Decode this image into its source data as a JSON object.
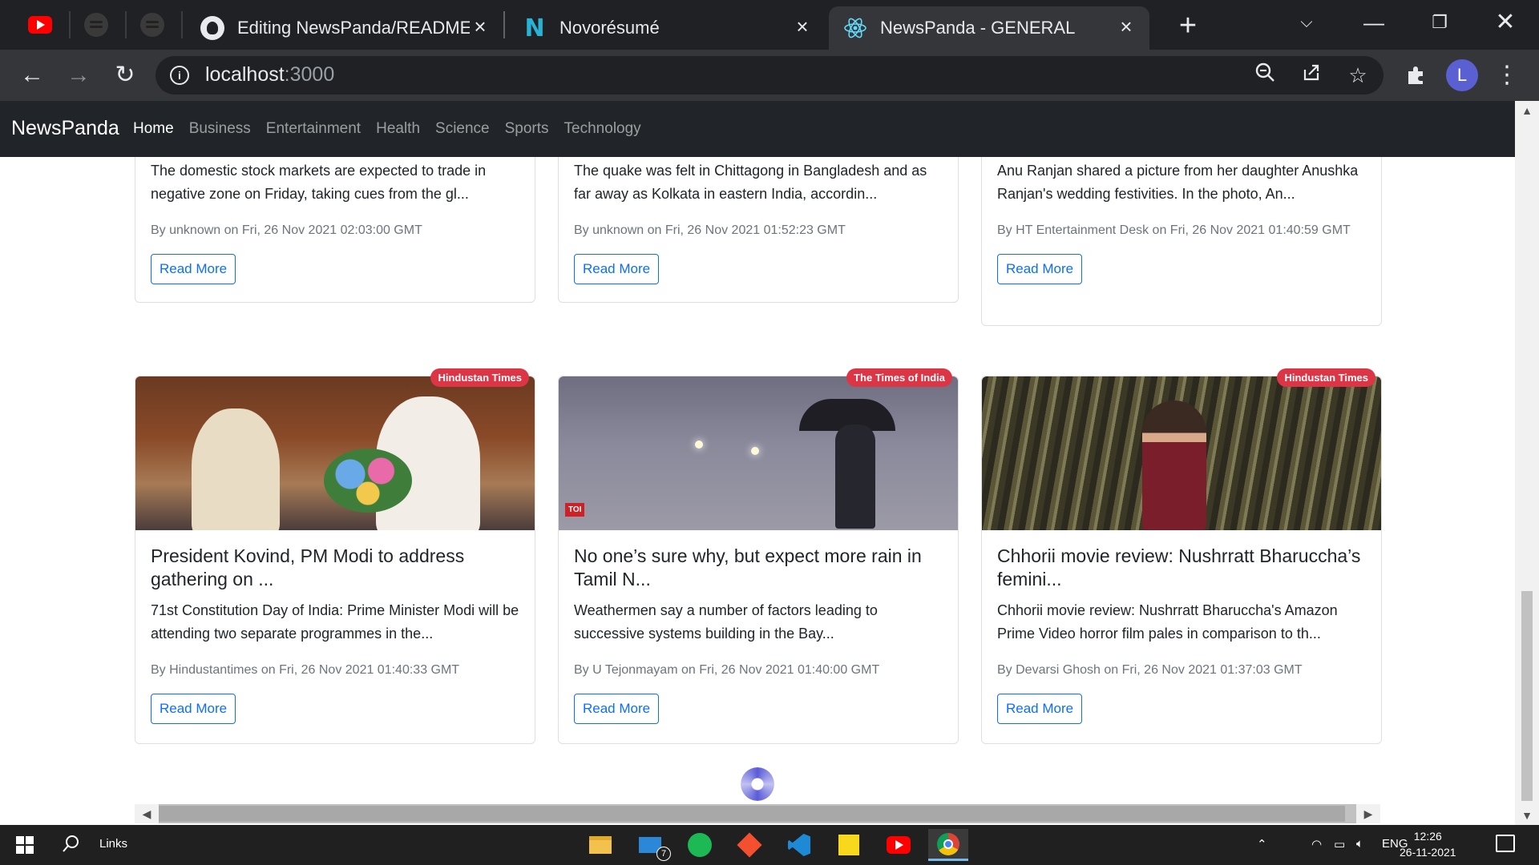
{
  "browser": {
    "tabs": [
      {
        "title": "Editing NewsPanda/README.md",
        "icon": "github-icon"
      },
      {
        "title": "Novorésumé",
        "icon": "novoresume-icon"
      },
      {
        "title": "NewsPanda - GENERAL",
        "icon": "react-icon",
        "active": true
      }
    ],
    "url_host": "localhost",
    "url_port": ":3000",
    "avatar_letter": "L"
  },
  "navbar": {
    "brand": "NewsPanda",
    "links": [
      "Home",
      "Business",
      "Entertainment",
      "Health",
      "Science",
      "Sports",
      "Technology"
    ]
  },
  "cards_top": [
    {
      "description": "The domestic stock markets are expected to trade in negative zone on Friday, taking cues from the gl...",
      "byline": "By unknown on Fri, 26 Nov 2021 02:03:00 GMT",
      "button": "Read More"
    },
    {
      "description": "The quake was felt in Chittagong in Bangladesh and as far away as Kolkata in eastern India, accordin...",
      "byline": "By unknown on Fri, 26 Nov 2021 01:52:23 GMT",
      "button": "Read More"
    },
    {
      "description": "Anu Ranjan shared a picture from her daughter Anushka Ranjan's wedding festivities. In the photo, An...",
      "byline": "By HT Entertainment Desk on Fri, 26 Nov 2021 01:40:59 GMT",
      "button": "Read More"
    }
  ],
  "cards_bottom": [
    {
      "source": "Hindustan Times",
      "title": "President Kovind, PM Modi to address gathering on ...",
      "description": "71st Constitution Day of India: Prime Minister Modi will be attending two separate programmes in the...",
      "byline": "By Hindustantimes on Fri, 26 Nov 2021 01:40:33 GMT",
      "button": "Read More"
    },
    {
      "source": "The Times of India",
      "title": "No one’s sure why, but expect more rain in Tamil N...",
      "description": "Weathermen say a number of factors leading to successive systems building in the Bay...",
      "byline": "By U Tejonmayam on Fri, 26 Nov 2021 01:40:00 GMT",
      "button": "Read More",
      "image_logo": "TOI"
    },
    {
      "source": "Hindustan Times",
      "title": "Chhorii movie review: Nushrratt Bharuccha’s femini...",
      "description": "Chhorii movie review: Nushrratt Bharuccha's Amazon Prime Video horror film pales in comparison to th...",
      "byline": "By Devarsi Ghosh on Fri, 26 Nov 2021 01:37:03 GMT",
      "button": "Read More"
    }
  ],
  "taskbar": {
    "links_label": "Links",
    "mail_badge": "7",
    "language": "ENG",
    "time": "12:26",
    "date": "26-11-2021"
  },
  "colors": {
    "navbar_bg": "#212529",
    "badge_bg": "#dc3545",
    "button_primary": "#0d6efd",
    "spinner": "#3f3fd1"
  }
}
